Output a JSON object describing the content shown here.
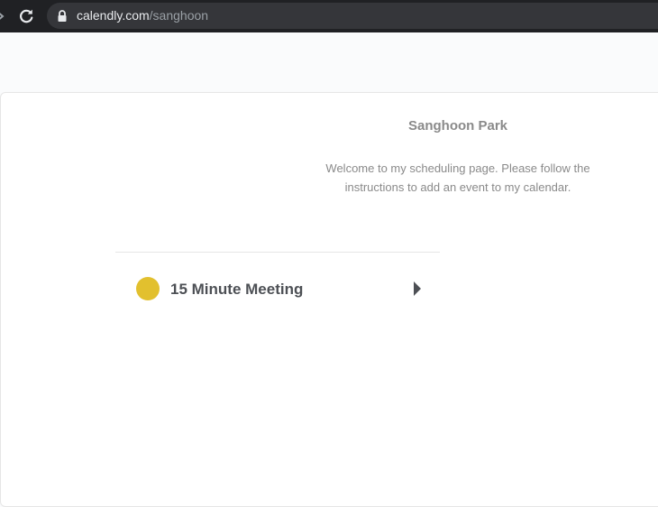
{
  "browser": {
    "url_domain": "calendly.com",
    "url_path": "/sanghoon"
  },
  "profile": {
    "name": "Sanghoon Park",
    "welcome_message": "Welcome to my scheduling page. Please follow the instructions to add an event to my calendar."
  },
  "events": [
    {
      "title": "15 Minute Meeting",
      "color": "#e2c02e"
    }
  ],
  "colors": {
    "chrome_bg": "#202124",
    "omnibox_bg": "#35363a",
    "page_bg": "#fafbfc",
    "card_bg": "#ffffff",
    "muted_text": "#8a8a8a",
    "title_text": "#4d5055"
  },
  "icons": {
    "forward": "chevron-right-icon",
    "reload": "reload-icon",
    "lock": "lock-icon",
    "event_arrow": "triangle-right-icon"
  }
}
